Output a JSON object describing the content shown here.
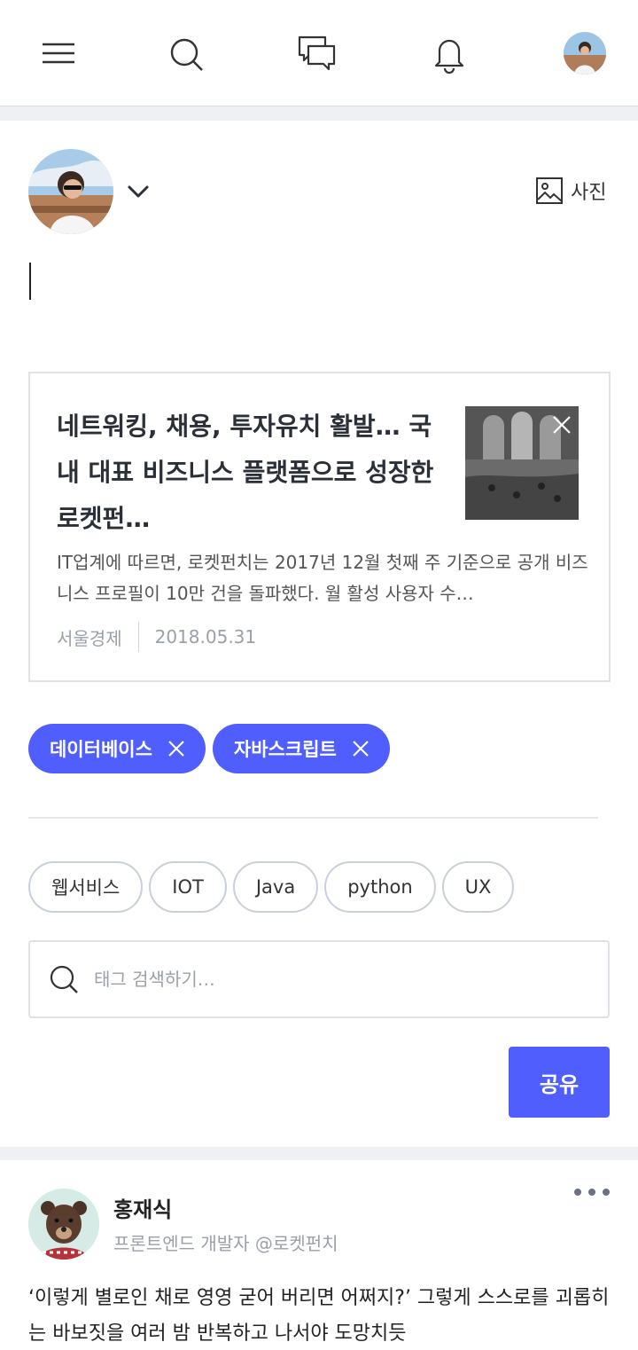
{
  "topbar": {
    "icons": [
      "menu-icon",
      "search-icon",
      "chat-icon",
      "bell-icon",
      "profile-avatar"
    ]
  },
  "composer": {
    "photo_label": "사진",
    "link_card": {
      "title": "네트워킹, 채용, 투자유치 활발… 국내 대표 비즈니스 플랫폼으로 성장한 로켓펀…",
      "description": "IT업계에 따르면, 로켓펀치는 2017년 12월 첫째 주 기준으로 공개 비즈니스 프로필이 10만 건을 돌파했다. 월 활성 사용자 수…",
      "source": "서울경제",
      "date": "2018.05.31"
    },
    "selected_tags": [
      {
        "label": "데이터베이스"
      },
      {
        "label": "자바스크립트"
      }
    ],
    "suggested_tags": [
      {
        "label": "웹서비스"
      },
      {
        "label": "IOT"
      },
      {
        "label": "Java"
      },
      {
        "label": "python"
      },
      {
        "label": "UX"
      }
    ],
    "tag_search": {
      "placeholder": "태그 검색하기…",
      "value": ""
    },
    "share_label": "공유"
  },
  "post": {
    "author": "홍재식",
    "subtitle": "프론트엔드 개발자 @로켓펀치",
    "body": "‘이렇게 별로인 채로 영영 굳어 버리면 어쩌지?’ 그렇게 스스로를 괴롭히는 바보짓을 여러 밤 반복하고 나서야 도망치듯"
  },
  "colors": {
    "accent": "#4f5efc",
    "border": "#dfe2e8",
    "muted_text": "#9aa0ab",
    "page_bg": "#eef0f4"
  }
}
